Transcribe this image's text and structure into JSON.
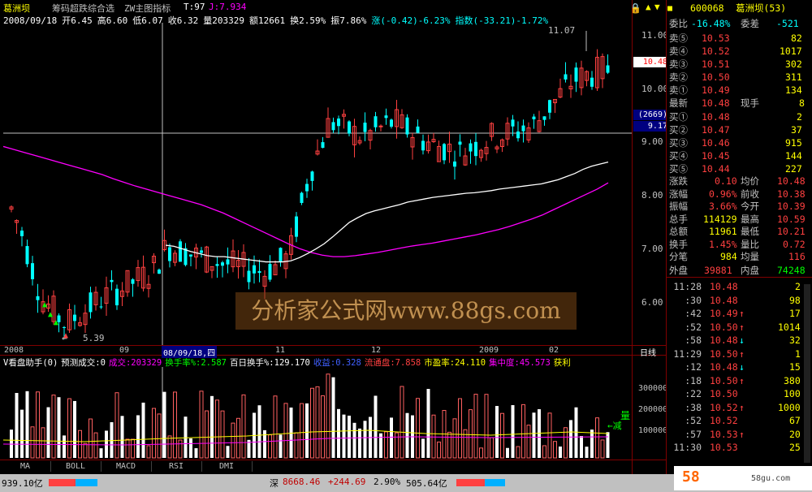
{
  "header": {
    "stock_name": "葛洲坝",
    "menus": [
      "筹码超跌综合选",
      "ZW主图指标"
    ],
    "t_label": "T:97",
    "j_label": "J:7.934"
  },
  "info": {
    "date": "2008/09/18",
    "open": "开6.45",
    "high": "高6.60",
    "low": "低6.07",
    "close": "收6.32",
    "volume": "量203329",
    "amount": "额12661",
    "turnover": "换2.59%",
    "amplitude": "振7.86%",
    "change": "涨(-0.42)-6.23%",
    "index": "指数(-33.21)-1.72%"
  },
  "price_axis": [
    "11.00",
    "10.00",
    "9.00",
    "8.00",
    "7.00",
    "6.00"
  ],
  "price_tags": {
    "current": "10.48",
    "cursor_count": "(2669)",
    "cursor_price": "9.17"
  },
  "annotations": {
    "high": "11.07",
    "low": "5.39",
    "vol_text1": "量",
    "vol_text2": "←减"
  },
  "x_labels": [
    "2008",
    "09",
    "08/09/18,四",
    "11",
    "12",
    "2009",
    "02",
    "日线"
  ],
  "vol_axis": [
    "300000",
    "200000",
    "100000"
  ],
  "vol_indicator": {
    "name": "V看盘助手(0)",
    "pred": "预测成交:0",
    "chengjiao": "成交:203329",
    "huanshou": "换手率%:2.587",
    "baiday": "百日换手%:129.170",
    "shouyi": "收益:0.328",
    "liutong": "流通盘:7.858",
    "shiying": "市盈率:24.110",
    "jizhong": "集中度:45.573",
    "huoli": "获利"
  },
  "tabs": [
    "MA",
    "BOLL",
    "MACD",
    "RSI",
    "DMI"
  ],
  "status": {
    "left_amount": "939.10亿",
    "shen_label": "深",
    "shen_value": "8668.46",
    "shen_change": "+244.69",
    "shen_pct": "2.90%",
    "shen_amount": "505.64亿"
  },
  "quote": {
    "code": "600068",
    "name": "葛洲坝(53)",
    "weibi_label": "委比",
    "weibi_value": "-16.48%",
    "weicha_label": "委差",
    "weicha_value": "-521",
    "sells": [
      {
        "label": "卖⑤",
        "price": "10.53",
        "vol": "82"
      },
      {
        "label": "卖④",
        "price": "10.52",
        "vol": "1017"
      },
      {
        "label": "卖③",
        "price": "10.51",
        "vol": "302"
      },
      {
        "label": "卖②",
        "price": "10.50",
        "vol": "311"
      },
      {
        "label": "卖①",
        "price": "10.49",
        "vol": "134"
      }
    ],
    "latest_label": "最新",
    "latest_value": "10.48",
    "xianshou_label": "现手",
    "xianshou_value": "8",
    "buys": [
      {
        "label": "买①",
        "price": "10.48",
        "vol": "2"
      },
      {
        "label": "买②",
        "price": "10.47",
        "vol": "37"
      },
      {
        "label": "买③",
        "price": "10.46",
        "vol": "915"
      },
      {
        "label": "买④",
        "price": "10.45",
        "vol": "144"
      },
      {
        "label": "买⑤",
        "price": "10.44",
        "vol": "227"
      }
    ],
    "stats": [
      {
        "l1": "涨跌",
        "v1": "0.10",
        "l2": "均价",
        "v2": "10.48"
      },
      {
        "l1": "涨幅",
        "v1": "0.96%",
        "l2": "前收",
        "v2": "10.38"
      },
      {
        "l1": "振幅",
        "v1": "3.66%",
        "l2": "今开",
        "v2": "10.39"
      },
      {
        "l1": "总手",
        "v1": "114129",
        "l2": "最高",
        "v2": "10.59"
      },
      {
        "l1": "总额",
        "v1": "11961",
        "l2": "最低",
        "v2": "10.21"
      },
      {
        "l1": "换手",
        "v1": "1.45%",
        "l2": "量比",
        "v2": "0.72"
      },
      {
        "l1": "分笔",
        "v1": "984",
        "l2": "均量",
        "v2": "116"
      }
    ],
    "waipan_label": "外盘",
    "waipan_value": "39881",
    "neipan_label": "内盘",
    "neipan_value": "74248",
    "ticks": [
      {
        "time": "11:28",
        "price": "10.48",
        "arrow": "",
        "vol": "2"
      },
      {
        "time": ":30",
        "price": "10.48",
        "arrow": "",
        "vol": "98"
      },
      {
        "time": ":42",
        "price": "10.49",
        "arrow": "↑",
        "vol": "17"
      },
      {
        "time": ":52",
        "price": "10.50",
        "arrow": "↑",
        "vol": "1014"
      },
      {
        "time": ":58",
        "price": "10.48",
        "arrow": "↓",
        "vol": "32"
      },
      {
        "time": "11:29",
        "price": "10.50",
        "arrow": "↑",
        "vol": "1"
      },
      {
        "time": ":12",
        "price": "10.48",
        "arrow": "↓",
        "vol": "15"
      },
      {
        "time": ":18",
        "price": "10.50",
        "arrow": "↑",
        "vol": "380"
      },
      {
        "time": ":22",
        "price": "10.50",
        "arrow": "",
        "vol": "100"
      },
      {
        "time": ":38",
        "price": "10.52",
        "arrow": "↑",
        "vol": "1000"
      },
      {
        "time": ":52",
        "price": "10.52",
        "arrow": "",
        "vol": "67"
      },
      {
        "time": ":57",
        "price": "10.53",
        "arrow": "↑",
        "vol": "20"
      },
      {
        "time": "11:30",
        "price": "10.53",
        "arrow": "",
        "vol": "25"
      }
    ]
  },
  "watermark": "分析家公式网www.88gs.com",
  "corner_logo": "58",
  "corner_text": "58gu.com",
  "chart_data": {
    "type": "candlestick",
    "ylim": [
      5.2,
      11.4
    ],
    "ma_white": [
      7.12,
      7.1,
      7.05,
      7.0,
      6.96,
      6.92,
      6.9,
      6.9,
      6.88,
      6.86,
      6.84,
      6.82,
      6.8,
      6.8,
      6.8,
      6.82,
      6.88,
      6.96,
      7.05,
      7.15,
      7.28,
      7.42,
      7.56,
      7.65,
      7.73,
      7.78,
      7.82,
      7.86,
      7.9,
      7.95,
      7.98,
      8.01,
      8.04,
      8.06,
      8.08,
      8.1,
      8.12,
      8.13,
      8.15,
      8.17,
      8.2,
      8.22,
      8.24,
      8.26,
      8.28,
      8.3,
      8.34,
      8.38,
      8.44,
      8.5,
      8.58,
      8.64,
      8.68,
      8.72
    ],
    "ma_purple": [
      9.02,
      8.96,
      8.9,
      8.84,
      8.78,
      8.72,
      8.66,
      8.6,
      8.54,
      8.48,
      8.4,
      8.33,
      8.26,
      8.2,
      8.14,
      8.08,
      8.02,
      7.96,
      7.9,
      7.82,
      7.74,
      7.64,
      7.54,
      7.44,
      7.34,
      7.24,
      7.14,
      7.05,
      6.98,
      6.93,
      6.9,
      6.9,
      6.92,
      6.95,
      6.98,
      7.02,
      7.06,
      7.1,
      7.13,
      7.16,
      7.2,
      7.24,
      7.28,
      7.32,
      7.37,
      7.42,
      7.48,
      7.55,
      7.62,
      7.7,
      7.8,
      7.9,
      8.0,
      8.1,
      8.2,
      8.32
    ]
  }
}
